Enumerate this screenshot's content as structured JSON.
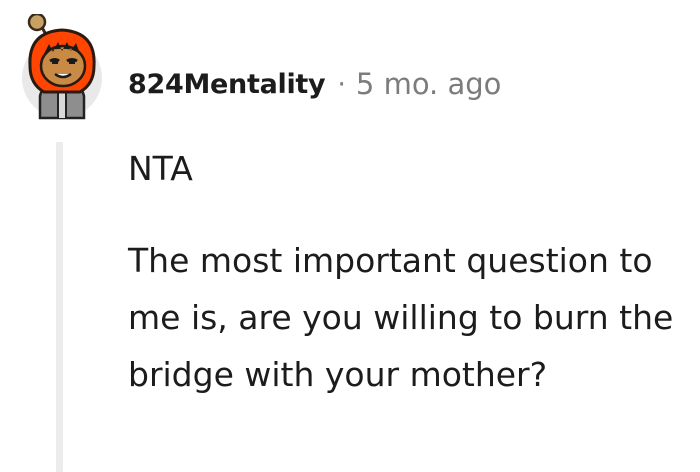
{
  "comment": {
    "author": {
      "username": "824Mentality",
      "avatar_icon": "snoo-avatar-orange-hood"
    },
    "separator": "·",
    "timestamp": "5 mo. ago",
    "paragraphs": [
      "NTA",
      "The most important question to me is, are you willing to burn the bridge with your mother?"
    ]
  },
  "colors": {
    "text": "#1c1c1c",
    "meta": "#7c7c7c",
    "thread_line": "#ececec",
    "avatar_bg": "#e9e9e9",
    "hood": "#ff4500"
  }
}
